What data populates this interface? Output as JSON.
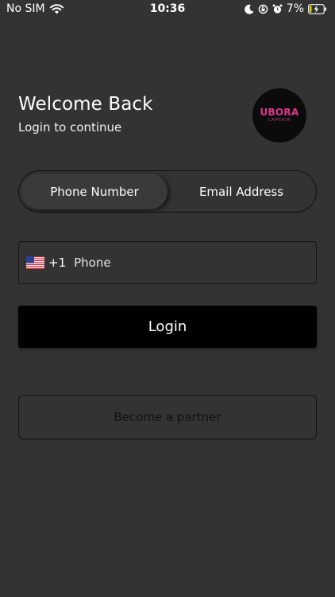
{
  "status_bar": {
    "carrier": "No SIM",
    "time": "10:36",
    "battery": "7%",
    "icons": [
      "wifi-icon",
      "moon-icon",
      "orientation-lock-icon",
      "alarm-icon",
      "battery-charging-icon"
    ]
  },
  "header": {
    "title": "Welcome Back",
    "subtitle": "Login to continue"
  },
  "logo": {
    "main": "UBORA",
    "sub": "CAPTAIN",
    "accent_color": "#e0358a"
  },
  "login_method": {
    "tabs": [
      "Phone Number",
      "Email Address"
    ],
    "selected": "Phone Number"
  },
  "phone_field": {
    "country_icon": "us-flag-icon",
    "dial_code": "+1",
    "placeholder": "Phone",
    "value": ""
  },
  "actions": {
    "login_label": "Login",
    "partner_label": "Become a partner"
  }
}
